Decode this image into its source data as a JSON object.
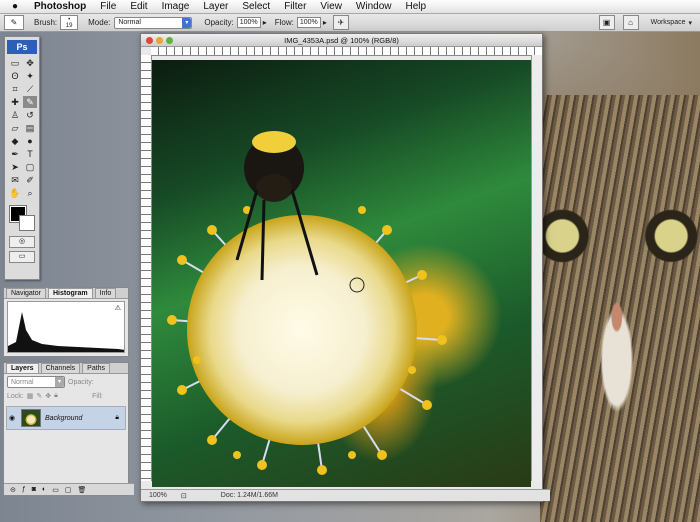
{
  "menubar": {
    "apple_icon": "apple-icon",
    "app": "Photoshop",
    "items": [
      "File",
      "Edit",
      "Image",
      "Layer",
      "Select",
      "Filter",
      "View",
      "Window",
      "Help"
    ]
  },
  "options": {
    "brush_label": "Brush:",
    "brush_size": "19",
    "mode_label": "Mode:",
    "mode_value": "Normal",
    "opacity_label": "Opacity:",
    "opacity_value": "100%",
    "flow_label": "Flow:",
    "flow_value": "100%",
    "workspace": "Workspace"
  },
  "toolbox": {
    "logo": "Ps"
  },
  "navigator": {
    "tabs": [
      "Navigator",
      "Histogram",
      "Info"
    ],
    "active": "Histogram"
  },
  "layers": {
    "tabs": [
      "Layers",
      "Channels",
      "Paths"
    ],
    "blend": "Normal",
    "opacity_label": "Opacity:",
    "lock_label": "Lock:",
    "fill_label": "Fill:",
    "layer_name": "Background"
  },
  "document": {
    "title": "IMG_4353A.psd @ 100% (RGB/8)",
    "zoom": "100%",
    "doc_info": "Doc: 1.24M/1.66M"
  }
}
